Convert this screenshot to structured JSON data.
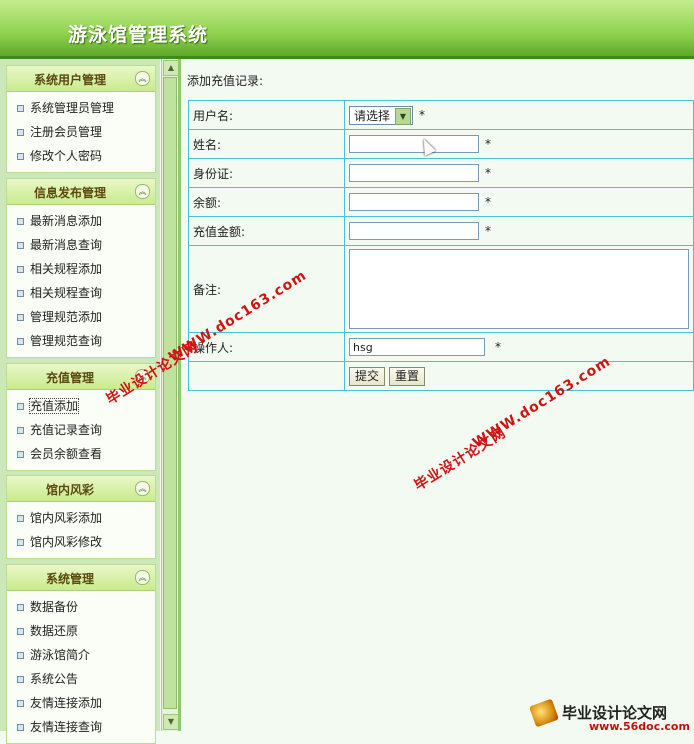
{
  "header": {
    "title": "游泳馆管理系统"
  },
  "sidebar": {
    "panels": [
      {
        "title": "系统用户管理",
        "items": [
          "系统管理员管理",
          "注册会员管理",
          "修改个人密码"
        ]
      },
      {
        "title": "信息发布管理",
        "items": [
          "最新消息添加",
          "最新消息查询",
          "相关规程添加",
          "相关规程查询",
          "管理规范添加",
          "管理规范查询"
        ]
      },
      {
        "title": "充值管理",
        "items": [
          "充值添加",
          "充值记录查询",
          "会员余额查看"
        ]
      },
      {
        "title": "馆内风彩",
        "items": [
          "馆内风彩添加",
          "馆内风彩修改"
        ]
      },
      {
        "title": "系统管理",
        "items": [
          "数据备份",
          "数据还原",
          "游泳馆简介",
          "系统公告",
          "友情连接添加",
          "友情连接查询"
        ]
      }
    ],
    "toggle_glyph": "︽"
  },
  "form": {
    "heading": "添加充值记录:",
    "username_label": "用户名:",
    "username_select": "请选择",
    "name_label": "姓名:",
    "idcard_label": "身份证:",
    "balance_label": "余额:",
    "amount_label": "充值金额:",
    "remark_label": "备注:",
    "operator_label": "操作人:",
    "operator_value": "hsg",
    "required_mark": "*",
    "submit_label": "提交",
    "reset_label": "重置"
  },
  "watermarks": {
    "cn": "毕业设计论文网",
    "url": "WWW.doc163.com"
  },
  "footer_logo": {
    "title": "毕业设计论文网",
    "url": "www.56doc.com"
  }
}
